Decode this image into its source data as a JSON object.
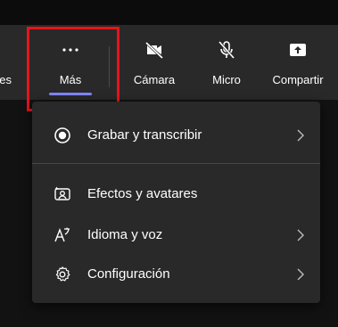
{
  "toolbar": {
    "truncated_label": "nes",
    "buttons": [
      {
        "label": "Más",
        "icon": "more-dots-icon",
        "selected": true
      },
      {
        "label": "Cámara",
        "icon": "camera-off-icon"
      },
      {
        "label": "Micro",
        "icon": "mic-off-icon"
      },
      {
        "label": "Compartir",
        "icon": "share-screen-icon"
      }
    ]
  },
  "menu": {
    "items": [
      {
        "label": "Grabar y transcribir",
        "icon": "record-icon",
        "has_submenu": true
      },
      {
        "label": "Efectos y avatares",
        "icon": "effects-icon",
        "has_submenu": false
      },
      {
        "label": "Idioma y voz",
        "icon": "language-icon",
        "has_submenu": true
      },
      {
        "label": "Configuración",
        "icon": "gear-icon",
        "has_submenu": true
      }
    ]
  },
  "colors": {
    "accent_underline": "#7f85f5",
    "highlight_box": "#e8141b",
    "surface": "#292929",
    "background": "#121212"
  }
}
